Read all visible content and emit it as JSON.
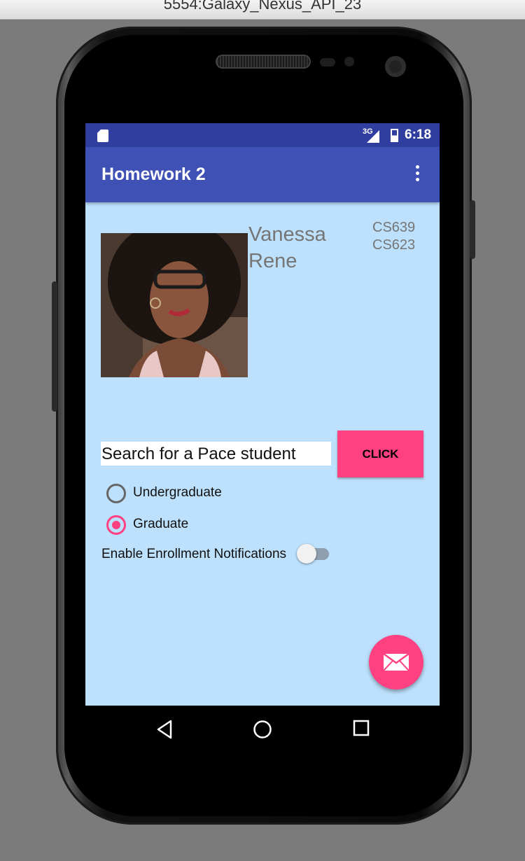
{
  "window": {
    "title": "5554:Galaxy_Nexus_API_23"
  },
  "status_bar": {
    "network": "3G",
    "time": "6:18"
  },
  "app_bar": {
    "title": "Homework 2",
    "menu_icon": "more-vert-icon"
  },
  "profile": {
    "first_name": "Vanessa",
    "last_name": "Rene",
    "courses": [
      "CS639",
      "CS623"
    ]
  },
  "search": {
    "value": "Search for a Pace student",
    "button_label": "CLICK"
  },
  "radio_group": {
    "options": [
      {
        "label": "Undergraduate",
        "checked": false
      },
      {
        "label": "Graduate",
        "checked": true
      }
    ]
  },
  "notifications": {
    "label": "Enable Enrollment Notifications",
    "enabled": false
  },
  "fab": {
    "icon": "email-icon"
  },
  "nav": {
    "back": "back-icon",
    "home": "home-icon",
    "recents": "recents-icon"
  },
  "colors": {
    "primary": "#3f51b5",
    "primary_dark": "#303f9f",
    "accent": "#ff4081",
    "background": "#bde1fd"
  }
}
